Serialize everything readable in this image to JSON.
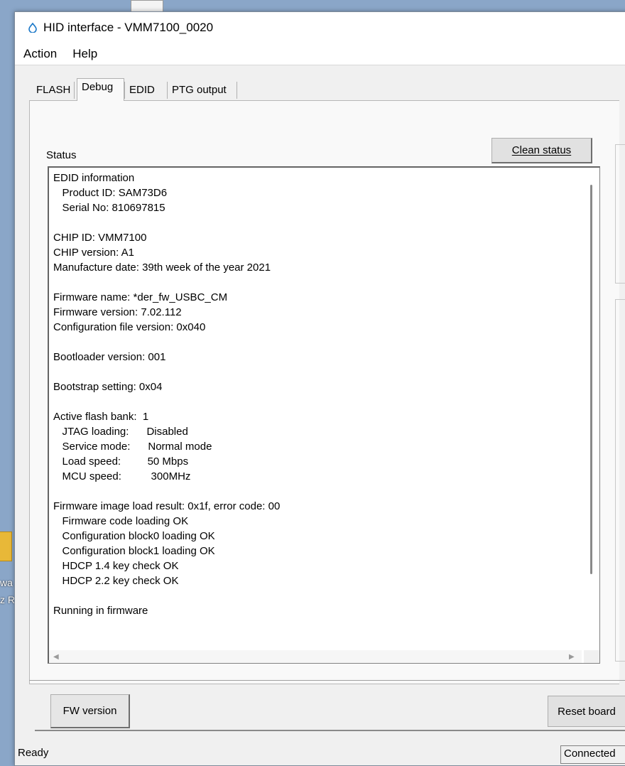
{
  "desktop": {
    "text_line1": "wa",
    "text_line2": "z R"
  },
  "window": {
    "title": "HID interface - VMM7100_0020"
  },
  "menu": [
    "Action",
    "Help"
  ],
  "tabs": [
    "FLASH",
    "Debug",
    "EDID",
    "PTG output"
  ],
  "active_tab": "Debug",
  "panel": {
    "status_label": "Status",
    "clean_button": "Clean status",
    "status_lines": [
      "EDID information",
      "   Product ID: SAM73D6",
      "   Serial No: 810697815",
      "",
      "CHIP ID: VMM7100",
      "CHIP version: A1",
      "Manufacture date: 39th week of the year 2021",
      "",
      "Firmware name: *der_fw_USBC_CM",
      "Firmware version: 7.02.112",
      "Configuration file version: 0x040",
      "",
      "Bootloader version: 001",
      "",
      "Bootstrap setting: 0x04",
      "",
      "Active flash bank:  1",
      "   JTAG loading:      Disabled",
      "   Service mode:      Normal mode",
      "   Load speed:         50 Mbps",
      "   MCU speed:          300MHz",
      "",
      "Firmware image load result: 0x1f, error code: 00",
      "   Firmware code loading OK",
      "   Configuration block0 loading OK",
      "   Configuration block1 loading OK",
      "   HDCP 1.4 key check OK",
      "   HDCP 2.2 key check OK",
      "",
      "Running in firmware"
    ]
  },
  "bottom": {
    "fw_button": "FW version",
    "reset_button": "Reset board"
  },
  "statusbar": {
    "left": "Ready",
    "right": "Connected"
  }
}
